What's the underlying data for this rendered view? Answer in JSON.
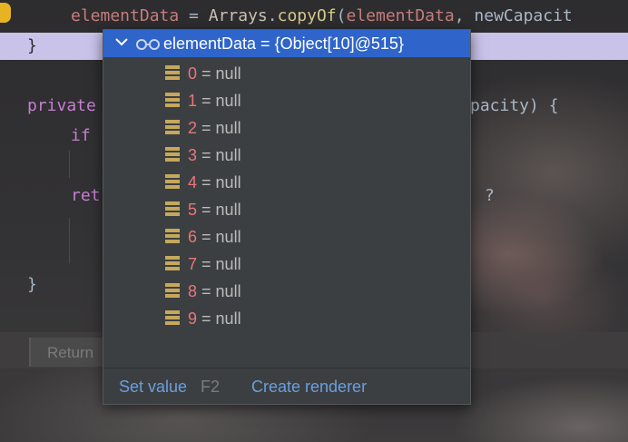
{
  "editor": {
    "line1": {
      "var": "elementData",
      "op": " = ",
      "cls": "Arrays",
      "dot": ".",
      "method": "copyOf",
      "args_open": "(",
      "arg1": "elementData",
      "sep": ", ",
      "arg2": "newCapacit"
    },
    "line2": "}",
    "line3_kw": "private",
    "line3_tail": "pacity) {",
    "line4_kw": "if",
    "line5_kw": "ret",
    "line5_tail": "?",
    "line6": "}",
    "bottom_hint": "Return"
  },
  "popup": {
    "header": "elementData = {Object[10]@515}",
    "header_icon": "glasses-icon",
    "expand_icon": "chevron-down-icon",
    "items": [
      {
        "index": "0",
        "value": "= null"
      },
      {
        "index": "1",
        "value": "= null"
      },
      {
        "index": "2",
        "value": "= null"
      },
      {
        "index": "3",
        "value": "= null"
      },
      {
        "index": "4",
        "value": "= null"
      },
      {
        "index": "5",
        "value": "= null"
      },
      {
        "index": "6",
        "value": "= null"
      },
      {
        "index": "7",
        "value": "= null"
      },
      {
        "index": "8",
        "value": "= null"
      },
      {
        "index": "9",
        "value": "= null"
      }
    ],
    "item_icon": "array-element-icon",
    "footer": {
      "set_value": "Set value",
      "set_value_shortcut": "F2",
      "create_renderer": "Create renderer"
    }
  },
  "colors": {
    "header_bg": "#2f65ca",
    "popup_bg": "#3c3f41",
    "index_color": "#e8777a",
    "link_color": "#6a9fdf",
    "highlight_line": "#c9c3ea"
  }
}
